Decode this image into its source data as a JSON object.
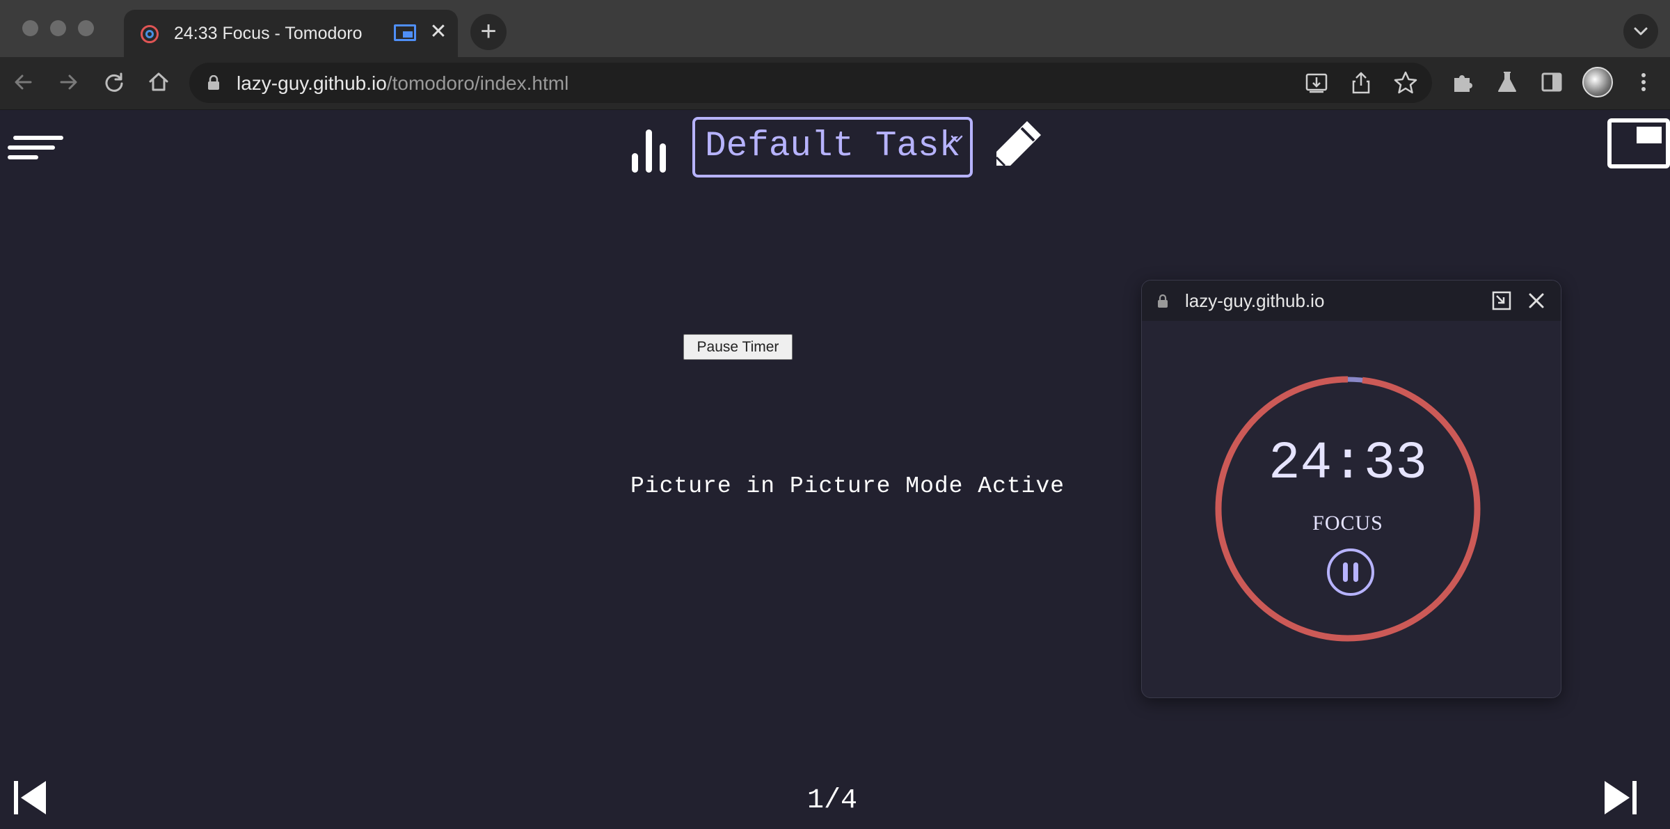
{
  "browser": {
    "tab": {
      "title": "24:33 Focus - Tomodoro",
      "close_label": "✕"
    },
    "newtab_label": "+",
    "url": {
      "host": "lazy-guy.github.io",
      "path": "/tomodoro/index.html"
    },
    "colors": {
      "tabstrip": "#3c3c3c",
      "toolbar": "#282828",
      "pip_indicator": "#4f8ff7"
    }
  },
  "app": {
    "task_select": {
      "value": "Default Task"
    },
    "pause_button": "Pause Timer",
    "pip_active_text": "Picture in Picture Mode Active",
    "page_counter": "1/4",
    "colors": {
      "background": "#22212f",
      "accent": "#b7b3ff",
      "ring": "#cc5a57"
    }
  },
  "pip_window": {
    "host": "lazy-guy.github.io",
    "timer": "24:33",
    "mode": "FOCUS",
    "progress_remaining": 0.982
  }
}
